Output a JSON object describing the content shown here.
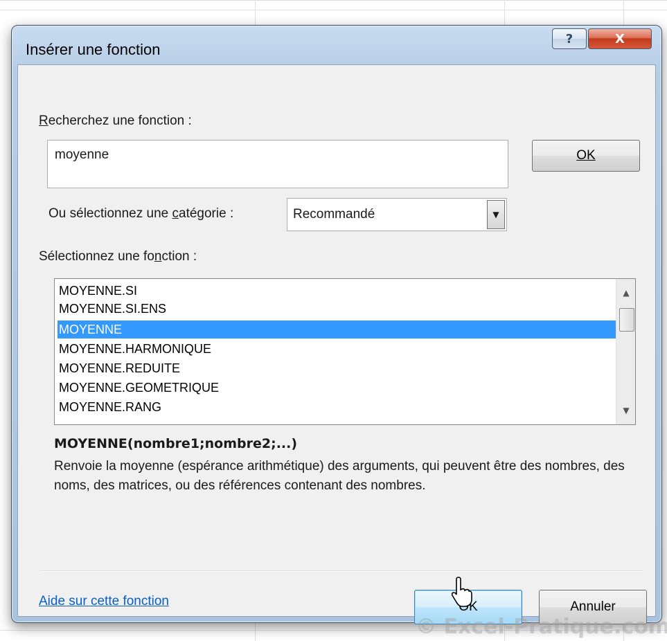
{
  "window": {
    "title": "Insérer une fonction",
    "help_glyph": "?",
    "close_glyph": "X"
  },
  "search": {
    "label_first": "R",
    "label_rest": "echerchez une fonction :",
    "value": "moyenne",
    "ok_label": "OK"
  },
  "category": {
    "label_before": "Ou sélectionnez une ",
    "label_ul": "c",
    "label_after": "atégorie :",
    "selected": "Recommandé"
  },
  "function_list": {
    "label_before": "Sélectionnez une fo",
    "label_ul": "n",
    "label_after": "ction :",
    "items": [
      "MOYENNE.SI",
      "MOYENNE.SI.ENS",
      "MOYENNE",
      "MOYENNE.HARMONIQUE",
      "MOYENNE.REDUITE",
      "MOYENNE.GEOMETRIQUE",
      "MOYENNE.RANG"
    ],
    "selected_index": 2
  },
  "details": {
    "signature": "MOYENNE(nombre1;nombre2;...)",
    "description": "Renvoie la moyenne (espérance arithmétique) des arguments, qui peuvent être des nombres, des noms, des matrices, ou des références contenant des nombres."
  },
  "footer": {
    "help_link": "Aide sur cette fonction",
    "ok_label": "OK",
    "cancel_label": "Annuler"
  },
  "watermark": "© Excel-Pratique.com",
  "colors": {
    "selection": "#3399ff",
    "link": "#0b5fc3",
    "close_button": "#c43a1c"
  }
}
